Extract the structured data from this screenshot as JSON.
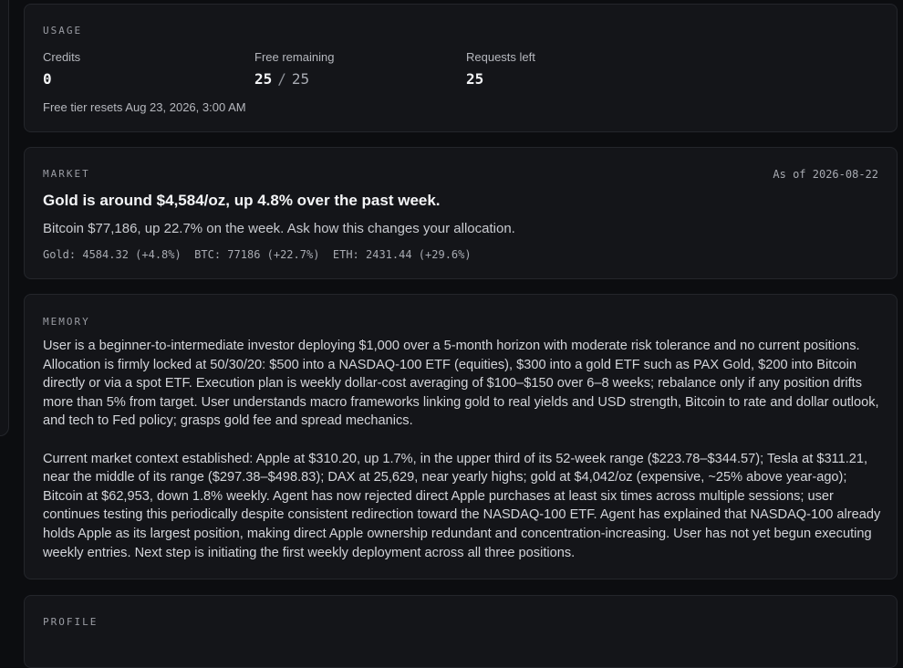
{
  "usage": {
    "label": "USAGE",
    "credits_label": "Credits",
    "credits_value": "0",
    "free_label": "Free remaining",
    "free_value": "25",
    "free_sep": "/",
    "free_total": "25",
    "requests_label": "Requests left",
    "requests_value": "25",
    "reset_text": "Free tier resets Aug 23, 2026, 3:00 AM"
  },
  "market": {
    "label": "MARKET",
    "as_of": "As of 2026-08-22",
    "headline": "Gold is around $4,584/oz, up 4.8% over the past week.",
    "subline": "Bitcoin $77,186, up 22.7% on the week. Ask how this changes your allocation.",
    "tickers": "Gold: 4584.32 (+4.8%)  BTC: 77186 (+22.7%)  ETH: 2431.44 (+29.6%)"
  },
  "memory": {
    "label": "MEMORY",
    "paragraph_1": "User is a beginner-to-intermediate investor deploying $1,000 over a 5-month horizon with moderate risk tolerance and no current positions. Allocation is firmly locked at 50/30/20: $500 into a NASDAQ-100 ETF (equities), $300 into a gold ETF such as PAX Gold, $200 into Bitcoin directly or via a spot ETF. Execution plan is weekly dollar-cost averaging of $100–$150 over 6–8 weeks; rebalance only if any position drifts more than 5% from target. User understands macro frameworks linking gold to real yields and USD strength, Bitcoin to rate and dollar outlook, and tech to Fed policy; grasps gold fee and spread mechanics.",
    "paragraph_2": "Current market context established: Apple at $310.20, up 1.7%, in the upper third of its 52-week range ($223.78–$344.57); Tesla at $311.21, near the middle of its range ($297.38–$498.83); DAX at 25,629, near yearly highs; gold at $4,042/oz (expensive, ~25% above year-ago); Bitcoin at $62,953, down 1.8% weekly. Agent has now rejected direct Apple purchases at least six times across multiple sessions; user continues testing this periodically despite consistent redirection toward the NASDAQ-100 ETF. Agent has explained that NASDAQ-100 already holds Apple as its largest position, making direct Apple ownership redundant and concentration-increasing. User has not yet begun executing weekly entries. Next step is initiating the first weekly deployment across all three positions."
  },
  "profile": {
    "label": "PROFILE"
  }
}
